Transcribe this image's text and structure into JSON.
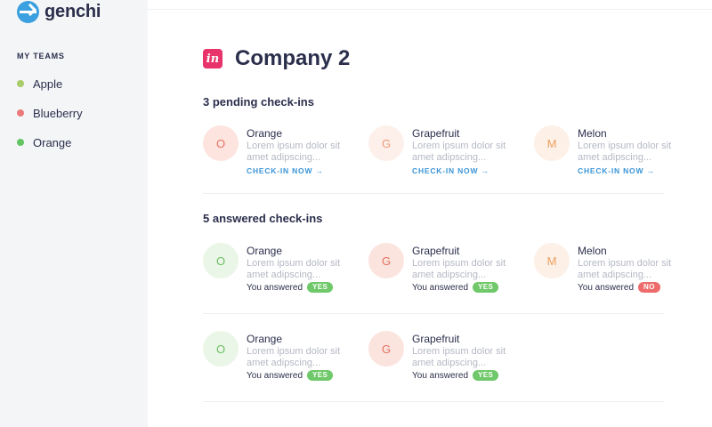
{
  "app": {
    "name": "genchi"
  },
  "sidebar": {
    "heading": "MY TEAMS",
    "teams": [
      {
        "label": "Apple",
        "color": "#a8cc6a"
      },
      {
        "label": "Blueberry",
        "color": "#ea7a79"
      },
      {
        "label": "Orange",
        "color": "#63c463"
      }
    ]
  },
  "company": {
    "badge": "in",
    "name": "Company 2",
    "badge_color": "#e8346b"
  },
  "pending": {
    "title": "3 pending check-ins",
    "cards": [
      {
        "initial": "O",
        "name": "Orange",
        "desc": "Lorem ipsum dolor sit amet adipscing...",
        "action": "CHECK-IN NOW →",
        "avatar_bg": "#fde4df",
        "avatar_fg": "#e67264"
      },
      {
        "initial": "G",
        "name": "Grapefruit",
        "desc": "Lorem ipsum dolor sit amet adipscing...",
        "action": "CHECK-IN NOW →",
        "avatar_bg": "#fdf0ea",
        "avatar_fg": "#ec9a79"
      },
      {
        "initial": "M",
        "name": "Melon",
        "desc": "Lorem ipsum dolor sit amet adipscing...",
        "action": "CHECK-IN NOW →",
        "avatar_bg": "#fdf0e7",
        "avatar_fg": "#efa05f"
      }
    ]
  },
  "answered": {
    "title": "5 answered check-ins",
    "cards": [
      {
        "initial": "O",
        "name": "Orange",
        "desc": "Lorem ipsum dolor sit amet adipscing...",
        "answer_label": "You answered",
        "answer": "YES",
        "avatar_bg": "#eaf6e7",
        "avatar_fg": "#6cc064"
      },
      {
        "initial": "G",
        "name": "Grapefruit",
        "desc": "Lorem ipsum dolor sit amet adipscing...",
        "answer_label": "You answered",
        "answer": "YES",
        "avatar_bg": "#fbe4de",
        "avatar_fg": "#e57162"
      },
      {
        "initial": "M",
        "name": "Melon",
        "desc": "Lorem ipsum dolor sit amet adipscing...",
        "answer_label": "You answered",
        "answer": "NO",
        "avatar_bg": "#fdf0e7",
        "avatar_fg": "#efa05f"
      },
      {
        "initial": "O",
        "name": "Orange",
        "desc": "Lorem ipsum dolor sit amet adipscing...",
        "answer_label": "You answered",
        "answer": "YES",
        "avatar_bg": "#eaf6e7",
        "avatar_fg": "#6cc064"
      },
      {
        "initial": "G",
        "name": "Grapefruit",
        "desc": "Lorem ipsum dolor sit amet adipscing...",
        "answer_label": "You answered",
        "answer": "YES",
        "avatar_bg": "#fbe4de",
        "avatar_fg": "#e57162"
      }
    ]
  },
  "colors": {
    "yes_badge": "#6fc86a",
    "no_badge": "#ee6b6b",
    "link": "#3a94d7"
  }
}
